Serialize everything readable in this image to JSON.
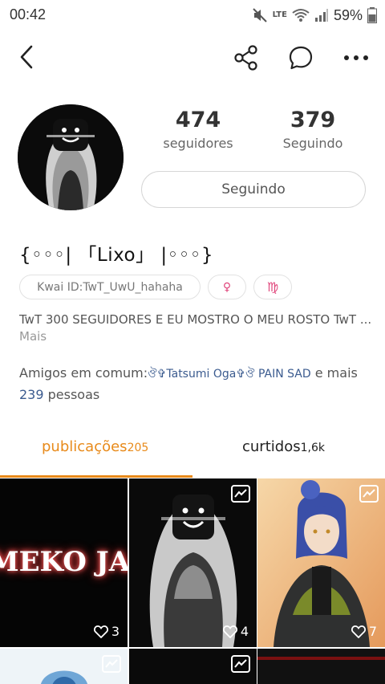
{
  "status_bar": {
    "time": "00:42",
    "network": "LTE",
    "battery": "59%"
  },
  "profile": {
    "followers_count": "474",
    "followers_label": "seguidores",
    "following_count": "379",
    "following_label": "Seguindo",
    "follow_button_label": "Seguindo",
    "display_name": "{◦◦◦| 「Lixo」 |◦◦◦}",
    "kwai_id": "Kwai ID:TwT_UwU_hahaha",
    "gender_symbol": "♀",
    "zodiac_symbol": "♍",
    "bio_text": "TwT 300 SEGUIDORES E EU MOSTRO O MEU ROSTO TwT ...",
    "bio_more": "Mais",
    "mutual_prefix": "Amigos em comum:",
    "mutual_names": "ঔ✞Tatsumi Oga✞ঔ PAIN SAD",
    "mutual_mid": " e mais ",
    "mutual_count": "239",
    "mutual_suffix": " pessoas"
  },
  "tabs": [
    {
      "label": "publicações",
      "count": "205",
      "active": true
    },
    {
      "label": "curtidos",
      "count": "1,6k",
      "active": false
    }
  ],
  "grid": [
    {
      "overlay_text": "MEKO JAB",
      "likes": "3"
    },
    {
      "likes": "4"
    },
    {
      "likes": "7"
    }
  ],
  "colors": {
    "accent": "#e88a1a",
    "link": "#3b5b8f",
    "chip_pink": "#e0457b"
  }
}
